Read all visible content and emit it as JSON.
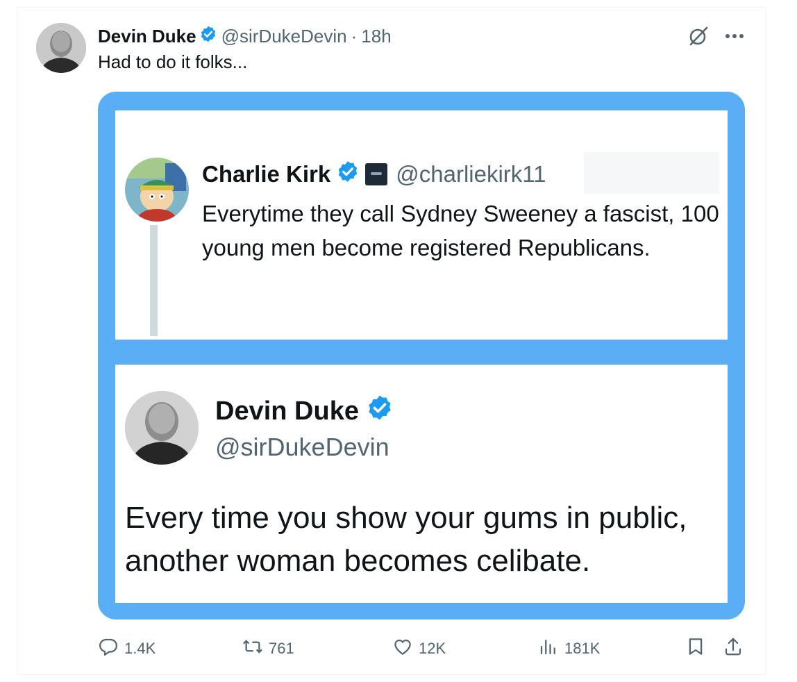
{
  "tweet": {
    "author_name": "Devin Duke",
    "author_handle": "@sirDukeDevin",
    "separator": "·",
    "time": "18h",
    "text": "Had to do it folks..."
  },
  "embedded_image": {
    "quoted_tweet": {
      "name": "Charlie Kirk",
      "handle": "@charliekirk11",
      "text": "Everytime they call Sydney Sweeney a fascist, 100 young men become registered Republicans."
    },
    "reply_tweet": {
      "name": "Devin Duke",
      "handle": "@sirDukeDevin",
      "text": "Every time you show your gums in public, another woman becomes celibate."
    }
  },
  "actions": {
    "replies": "1.4K",
    "reposts": "761",
    "likes": "12K",
    "views": "181K"
  },
  "colors": {
    "accent": "#1d9bf0",
    "media_border": "#5aaef5",
    "muted_text": "#536471"
  },
  "icons": [
    "verified-badge-icon",
    "grok-icon",
    "more-icon",
    "reply-icon",
    "repost-icon",
    "like-icon",
    "views-icon",
    "bookmark-icon",
    "share-icon"
  ]
}
